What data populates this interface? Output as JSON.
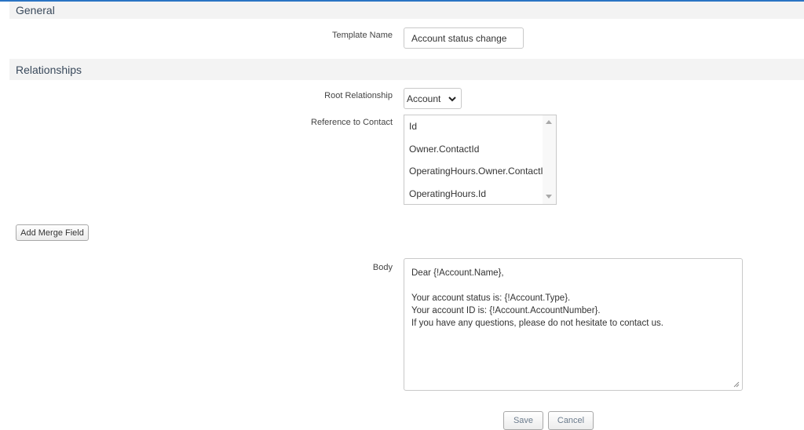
{
  "sections": {
    "general": "General",
    "relationships": "Relationships"
  },
  "template_name": {
    "label": "Template Name",
    "value": "Account status change"
  },
  "root_relationship": {
    "label": "Root Relationship",
    "selected": "Account",
    "icon": "chevron-down-icon"
  },
  "reference_to_contact": {
    "label": "Reference to Contact",
    "options": [
      "Id",
      "Owner.ContactId",
      "OperatingHours.Owner.ContactId",
      "OperatingHours.Id"
    ]
  },
  "add_merge_field": "Add Merge Field",
  "body": {
    "label": "Body",
    "lines": [
      "Dear {!Account.Name},",
      "",
      "Your account status is: {!Account.Type}.",
      "Your account ID is: {!Account.AccountNumber}.",
      "If you have any questions, please do not hesitate to contact us."
    ]
  },
  "buttons": {
    "save": "Save",
    "cancel": "Cancel"
  },
  "colors": {
    "accent": "#2a74c4",
    "section_bg": "#f3f3f3"
  }
}
